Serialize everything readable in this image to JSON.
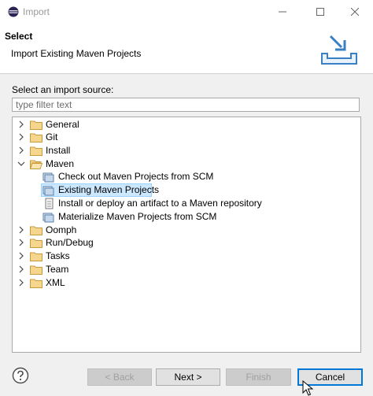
{
  "window": {
    "title": "Import",
    "icons": {
      "app": "eclipse-icon",
      "minimize": "minimize-icon",
      "maximize": "maximize-icon",
      "close": "close-icon"
    }
  },
  "header": {
    "title": "Select",
    "description": "Import Existing Maven Projects",
    "graphic": "import-wizard-banner-icon"
  },
  "source": {
    "label": "Select an import source:",
    "filter_placeholder": "type filter text",
    "filter_value": ""
  },
  "tree": {
    "items": [
      {
        "label": "General",
        "expanded": false,
        "type": "folder"
      },
      {
        "label": "Git",
        "expanded": false,
        "type": "folder"
      },
      {
        "label": "Install",
        "expanded": false,
        "type": "folder"
      },
      {
        "label": "Maven",
        "expanded": true,
        "type": "folder",
        "children": [
          {
            "label": "Check out Maven Projects from SCM",
            "icon": "maven-wizard-icon",
            "selected": false
          },
          {
            "label": "Existing Maven Projects",
            "icon": "maven-wizard-icon",
            "selected": true
          },
          {
            "label": "Install or deploy an artifact to a Maven repository",
            "icon": "maven-jar-icon",
            "selected": false
          },
          {
            "label": "Materialize Maven Projects from SCM",
            "icon": "maven-wizard-icon",
            "selected": false
          }
        ]
      },
      {
        "label": "Oomph",
        "expanded": false,
        "type": "folder"
      },
      {
        "label": "Run/Debug",
        "expanded": false,
        "type": "folder"
      },
      {
        "label": "Tasks",
        "expanded": false,
        "type": "folder"
      },
      {
        "label": "Team",
        "expanded": false,
        "type": "folder"
      },
      {
        "label": "XML",
        "expanded": false,
        "type": "folder"
      }
    ]
  },
  "footer": {
    "help_icon": "help-icon",
    "back_label": "< Back",
    "next_label": "Next >",
    "finish_label": "Finish",
    "cancel_label": "Cancel",
    "back_enabled": false,
    "finish_enabled": false
  },
  "colors": {
    "selection": "#cce8ff",
    "selection_border": "#99d1ff",
    "default_button_border": "#0078d7",
    "folder": "#dcb66b"
  }
}
